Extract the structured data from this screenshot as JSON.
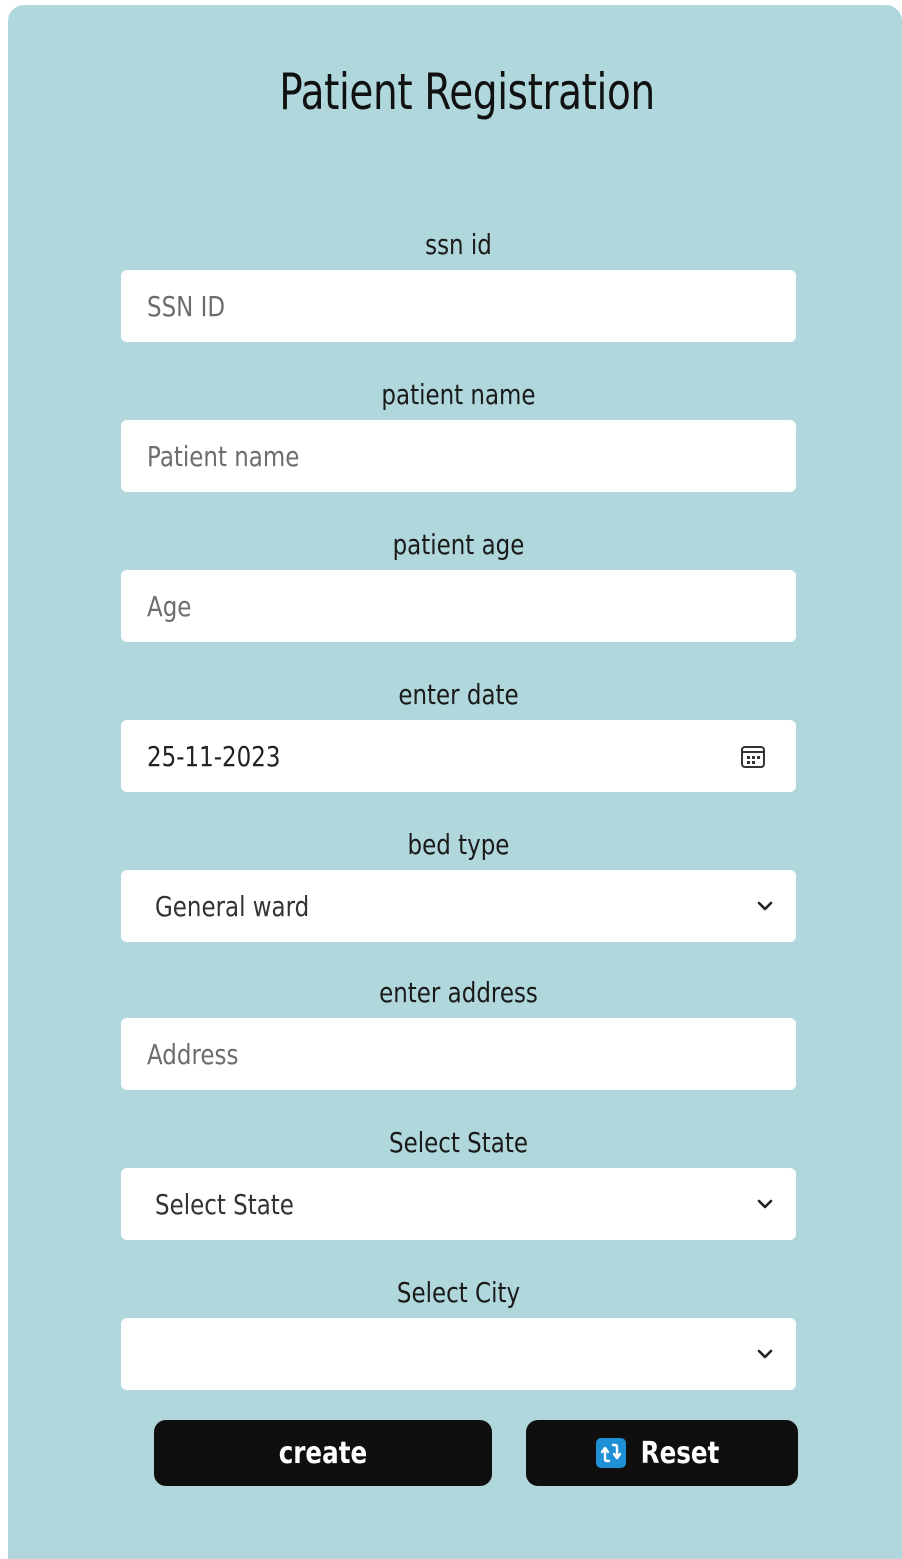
{
  "form": {
    "title": "Patient Registration",
    "fields": {
      "ssn": {
        "label": "ssn id",
        "placeholder": "SSN ID"
      },
      "name": {
        "label": "patient name",
        "placeholder": "Patient name"
      },
      "age": {
        "label": "patient age",
        "placeholder": "Age"
      },
      "date": {
        "label": "enter date",
        "value": "25-11-2023",
        "icon": "calendar-icon"
      },
      "bed": {
        "label": "bed type",
        "selected": "General ward",
        "icon": "chevron-down-icon"
      },
      "address": {
        "label": "enter address",
        "placeholder": "Address"
      },
      "state": {
        "label": "Select State",
        "selected": "Select State",
        "icon": "chevron-down-icon"
      },
      "city": {
        "label": "Select City",
        "selected": "",
        "icon": "chevron-down-icon"
      }
    },
    "buttons": {
      "create": "create",
      "reset": "Reset",
      "reset_icon": "refresh-icon"
    }
  },
  "colors": {
    "card_background": "#b0d8dc",
    "field_background": "#ffffff",
    "button_background": "#0f0f0f",
    "reset_icon": "#1f8fd6"
  }
}
